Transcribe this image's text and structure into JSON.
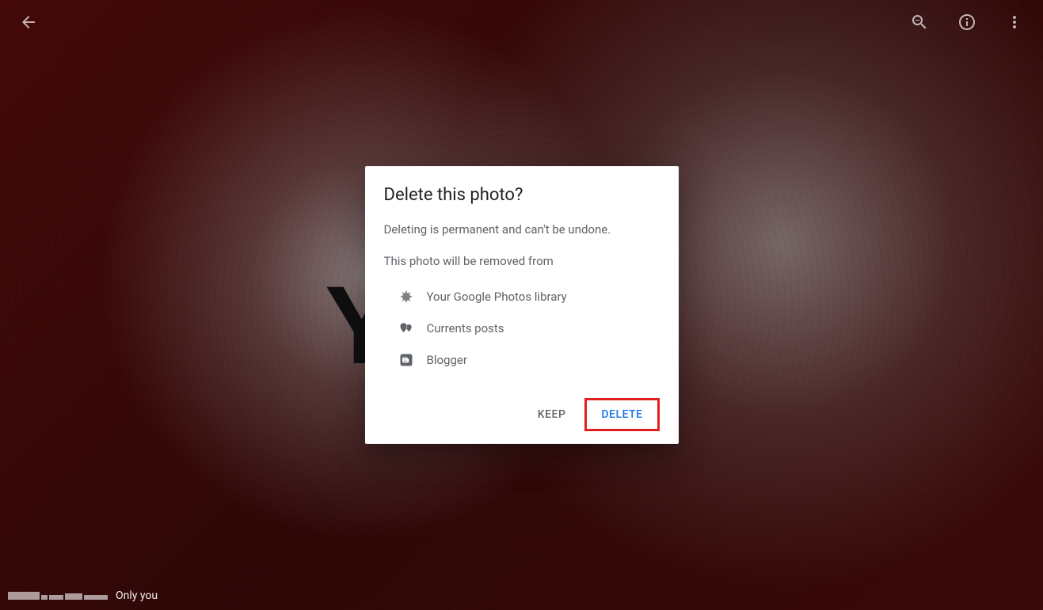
{
  "viewer": {
    "visibility_label": "Only you"
  },
  "dialog": {
    "title": "Delete this photo?",
    "warning": "Deleting is permanent and can't be undone.",
    "removed_from_label": "This photo will be removed from",
    "items": [
      {
        "label": "Your Google Photos library"
      },
      {
        "label": "Currents posts"
      },
      {
        "label": "Blogger"
      }
    ],
    "actions": {
      "keep": "KEEP",
      "delete": "DELETE"
    }
  }
}
